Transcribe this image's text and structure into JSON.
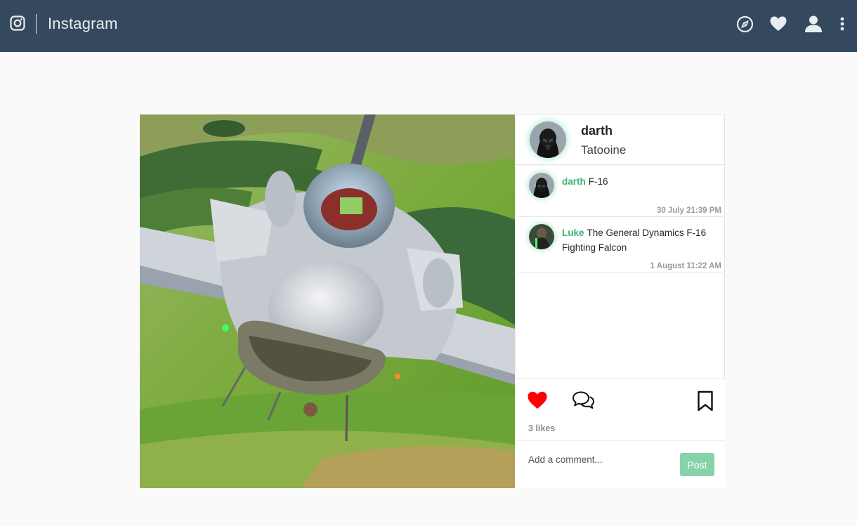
{
  "app": {
    "name": "Instagram"
  },
  "nav": {
    "icons": [
      "instagram-icon",
      "compass-icon",
      "heart-icon",
      "user-icon",
      "more-vertical-icon"
    ]
  },
  "post": {
    "author": {
      "username": "darth",
      "location": "Tatooine"
    },
    "comments": [
      {
        "username": "darth",
        "text": "F-16",
        "time": "30 July 21:39 PM"
      },
      {
        "username": "Luke",
        "text": "The General Dynamics F-16 Fighting Falcon",
        "time": "1 August 11:22 AM"
      }
    ],
    "likes_label": "3 likes",
    "liked": true,
    "add_comment": {
      "placeholder": "Add a comment...",
      "value": ""
    },
    "post_button_label": "Post"
  },
  "colors": {
    "navbar": "#34495e",
    "accent_green": "#3cb371",
    "post_button": "#86d3a9",
    "like_red": "#ff0000",
    "page_background": "#fafafa"
  }
}
